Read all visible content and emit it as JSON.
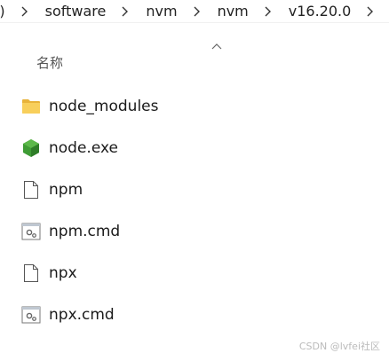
{
  "breadcrumb": {
    "items": [
      ":)",
      "software",
      "nvm",
      "nvm",
      "v16.20.0"
    ]
  },
  "column_header": {
    "name_label": "名称"
  },
  "files": [
    {
      "name": "node_modules",
      "icon": "folder-icon"
    },
    {
      "name": "node.exe",
      "icon": "nodejs-icon"
    },
    {
      "name": "npm",
      "icon": "file-icon"
    },
    {
      "name": "npm.cmd",
      "icon": "cmd-file-icon"
    },
    {
      "name": "npx",
      "icon": "file-icon"
    },
    {
      "name": "npx.cmd",
      "icon": "cmd-file-icon"
    }
  ],
  "watermark": {
    "text": "CSDN @lvfei社区"
  },
  "colors": {
    "folder": "#f5c542",
    "node_green": "#3f9c35",
    "text": "#1a1a1a"
  }
}
